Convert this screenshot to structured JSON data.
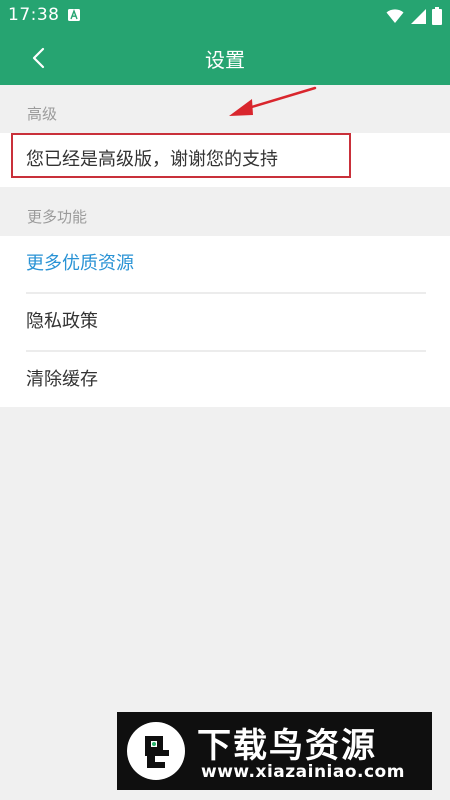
{
  "status_bar": {
    "time": "17:38",
    "icons": [
      "notification-a-icon",
      "wifi-icon",
      "signal-icon",
      "battery-icon"
    ]
  },
  "app_bar": {
    "title": "设置",
    "back_icon": "chevron-left-icon"
  },
  "sections": {
    "advanced": {
      "header": "高级",
      "items": [
        {
          "label": "您已经是高级版，谢谢您的支持"
        }
      ]
    },
    "more": {
      "header": "更多功能",
      "items": [
        {
          "label": "更多优质资源"
        },
        {
          "label": "隐私政策"
        },
        {
          "label": "清除缓存"
        }
      ]
    }
  },
  "watermark": {
    "title": "下载鸟资源",
    "url": "www.xiazainiao.com"
  },
  "colors": {
    "primary": "#26a471",
    "link": "#2a93d5",
    "highlight": "#c9303a",
    "background": "#f0f0f0"
  }
}
